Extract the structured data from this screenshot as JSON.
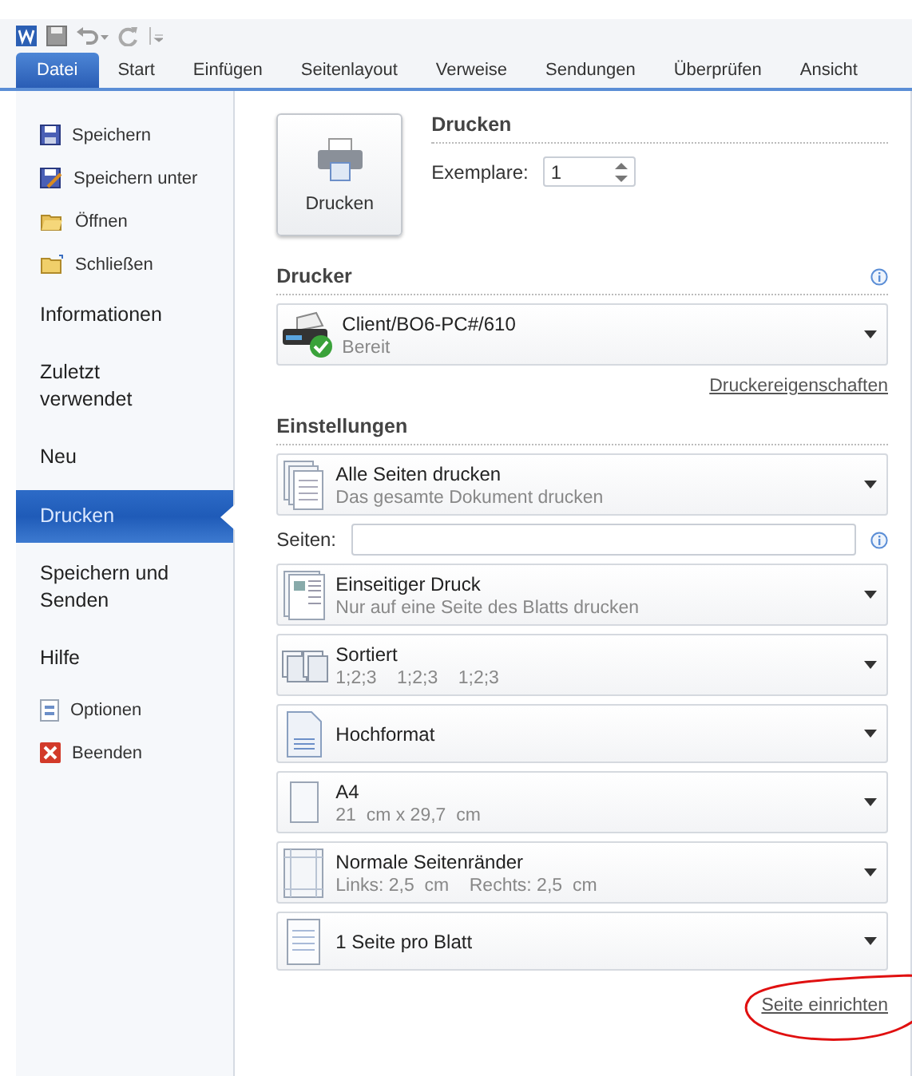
{
  "ribbon_tabs": [
    {
      "label": "Datei",
      "selected": true
    },
    {
      "label": "Start",
      "selected": false
    },
    {
      "label": "Einfügen",
      "selected": false
    },
    {
      "label": "Seitenlayout",
      "selected": false
    },
    {
      "label": "Verweise",
      "selected": false
    },
    {
      "label": "Sendungen",
      "selected": false
    },
    {
      "label": "Überprüfen",
      "selected": false
    },
    {
      "label": "Ansicht",
      "selected": false
    }
  ],
  "sidebar": {
    "items": [
      {
        "kind": "command",
        "label": "Speichern"
      },
      {
        "kind": "command",
        "label": "Speichern unter"
      },
      {
        "kind": "command",
        "label": "Öffnen"
      },
      {
        "kind": "command",
        "label": "Schließen"
      },
      {
        "kind": "page",
        "label": "Informationen",
        "selected": false
      },
      {
        "kind": "page",
        "label": "Zuletzt verwendet",
        "selected": false
      },
      {
        "kind": "page",
        "label": "Neu",
        "selected": false
      },
      {
        "kind": "page",
        "label": "Drucken",
        "selected": true
      },
      {
        "kind": "page",
        "label": "Speichern und Senden",
        "selected": false
      },
      {
        "kind": "page",
        "label": "Hilfe",
        "selected": false
      },
      {
        "kind": "command",
        "label": "Optionen"
      },
      {
        "kind": "command",
        "label": "Beenden"
      }
    ]
  },
  "print": {
    "button": "Drucken",
    "heading": "Drucken",
    "copies_label": "Exemplare:",
    "copies_value": "1"
  },
  "printer": {
    "heading": "Drucker",
    "name": "Client/BO6-PC#/610",
    "status": "Bereit",
    "link": "Druckereigenschaften"
  },
  "settings": {
    "heading": "Einstellungen",
    "items": [
      {
        "kind": "dropdown",
        "title": "Alle Seiten drucken",
        "subtitle": "Das gesamte Dokument drucken"
      },
      {
        "kind": "field",
        "label": "Seiten:"
      },
      {
        "kind": "dropdown",
        "title": "Einseitiger Druck",
        "subtitle": "Nur auf eine Seite des Blatts drucken"
      },
      {
        "kind": "dropdown",
        "title": "Sortiert",
        "subtitle": "1;2;3    1;2;3    1;2;3"
      },
      {
        "kind": "dropdown",
        "title": "Hochformat"
      },
      {
        "kind": "dropdown",
        "title": "A4",
        "subtitle": "21  cm x 29,7  cm"
      },
      {
        "kind": "dropdown",
        "title": "Normale Seitenränder",
        "subtitle": "Links: 2,5  cm    Rechts: 2,5  cm"
      },
      {
        "kind": "dropdown",
        "title": "1 Seite pro Blatt"
      }
    ],
    "link": "Seite einrichten"
  }
}
